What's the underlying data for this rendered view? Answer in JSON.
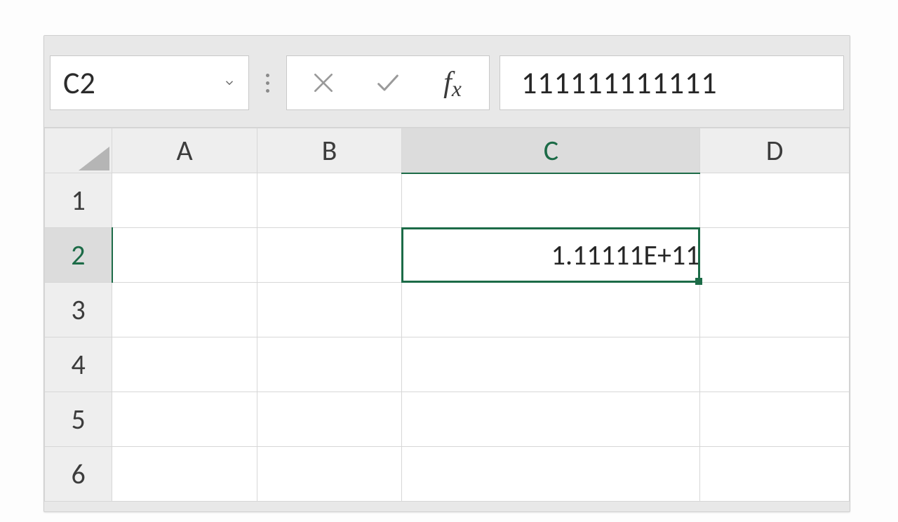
{
  "formula_bar": {
    "name_box": "C2",
    "formula_value": "111111111111",
    "fx_label_main": "f",
    "fx_label_sub": "x"
  },
  "columns": [
    "A",
    "B",
    "C",
    "D"
  ],
  "rows": [
    "1",
    "2",
    "3",
    "4",
    "5",
    "6"
  ],
  "selected_cell": {
    "col": "C",
    "row": "2",
    "display_value": "1.11111E+11",
    "raw_value": "111111111111"
  },
  "colors": {
    "selection_border": "#1c6b47",
    "header_bg": "#eeeeee",
    "header_selected_bg": "#dcdcdc"
  }
}
